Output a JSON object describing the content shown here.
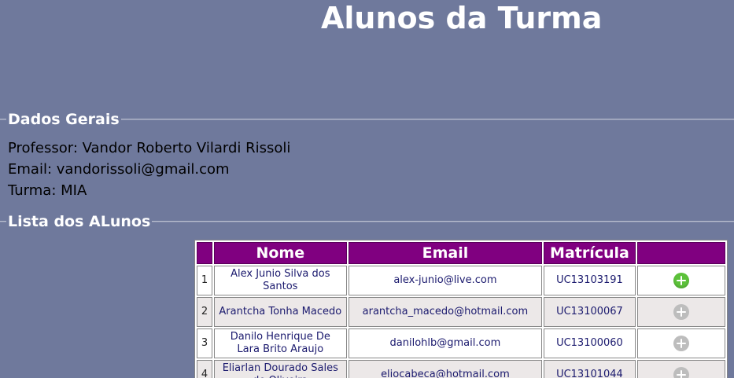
{
  "page": {
    "title": "Alunos da Turma"
  },
  "dados_gerais": {
    "legend": "Dados Gerais",
    "professor": "Professor: Vandor Roberto Vilardi Rissoli",
    "email": "Email: vandorissoli@gmail.com",
    "turma": "Turma: MIA"
  },
  "lista": {
    "legend": "Lista dos ALunos",
    "headers": {
      "num": "",
      "nome": "Nome",
      "email": "Email",
      "matricula": "Matrícula",
      "acao": ""
    },
    "rows": [
      {
        "num": "1",
        "nome": "Alex Junio Silva dos Santos",
        "email": "alex-junio@live.com",
        "matricula": "UC13103191",
        "icon": "add-circle-icon",
        "active": true
      },
      {
        "num": "2",
        "nome": "Arantcha Tonha Macedo",
        "email": "arantcha_macedo@hotmail.com",
        "matricula": "UC13100067",
        "icon": "add-circle-icon",
        "active": false
      },
      {
        "num": "3",
        "nome": "Danilo Henrique De Lara Brito Araujo",
        "email": "danilohlb@gmail.com",
        "matricula": "UC13100060",
        "icon": "add-circle-icon",
        "active": false
      },
      {
        "num": "4",
        "nome": "Eliarlan Dourado Sales de Oliveira",
        "email": "eliocabeca@hotmail.com",
        "matricula": "UC13101044",
        "icon": "add-circle-icon",
        "active": false
      }
    ]
  },
  "colors": {
    "background": "#6f799c",
    "header": "#800080",
    "add_active": "#5cc13a",
    "add_inactive": "#bdbdbd"
  }
}
